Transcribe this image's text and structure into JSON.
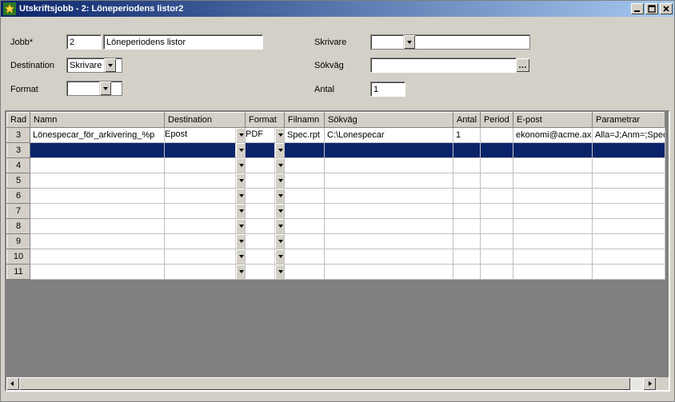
{
  "window": {
    "title": "Utskriftsjobb - 2: Löneperiodens listor2"
  },
  "form": {
    "jobb_label": "Jobb*",
    "jobb_id": "2",
    "jobb_name": "Löneperiodens listor",
    "destination_label": "Destination",
    "destination_value": "Skrivare",
    "format_label": "Format",
    "format_value": "",
    "skrivare_label": "Skrivare",
    "skrivare_value": "",
    "sokvag_label": "Sökväg",
    "sokvag_value": "",
    "antal_label": "Antal",
    "antal_value": "1"
  },
  "table": {
    "headers": {
      "rad": "Rad",
      "namn": "Namn",
      "destination": "Destination",
      "format": "Format",
      "filnamn": "Filnamn",
      "sokvag": "Sökväg",
      "antal": "Antal",
      "period": "Period",
      "epost": "E-post",
      "parametrar": "Parametrar"
    },
    "rows": [
      {
        "rad": "3",
        "namn": "Lönespecar_för_arkivering_%p",
        "destination": "Epost",
        "format": "PDF",
        "filnamn": "Spec.rpt",
        "sokvag": "C:\\Lonespecar",
        "antal": "1",
        "period": "",
        "epost": "ekonomi@acme.ax",
        "parametrar": "Alla=J;Anm=;SpecTyp=L;"
      },
      {
        "rad": "3",
        "namn": "",
        "destination": "",
        "format": "",
        "filnamn": "",
        "sokvag": "",
        "antal": "",
        "period": "",
        "epost": "",
        "parametrar": "",
        "selected": true
      },
      {
        "rad": "4",
        "namn": "",
        "destination": "",
        "format": "",
        "filnamn": "",
        "sokvag": "",
        "antal": "",
        "period": "",
        "epost": "",
        "parametrar": ""
      },
      {
        "rad": "5",
        "namn": "",
        "destination": "",
        "format": "",
        "filnamn": "",
        "sokvag": "",
        "antal": "",
        "period": "",
        "epost": "",
        "parametrar": ""
      },
      {
        "rad": "6",
        "namn": "",
        "destination": "",
        "format": "",
        "filnamn": "",
        "sokvag": "",
        "antal": "",
        "period": "",
        "epost": "",
        "parametrar": ""
      },
      {
        "rad": "7",
        "namn": "",
        "destination": "",
        "format": "",
        "filnamn": "",
        "sokvag": "",
        "antal": "",
        "period": "",
        "epost": "",
        "parametrar": ""
      },
      {
        "rad": "8",
        "namn": "",
        "destination": "",
        "format": "",
        "filnamn": "",
        "sokvag": "",
        "antal": "",
        "period": "",
        "epost": "",
        "parametrar": ""
      },
      {
        "rad": "9",
        "namn": "",
        "destination": "",
        "format": "",
        "filnamn": "",
        "sokvag": "",
        "antal": "",
        "period": "",
        "epost": "",
        "parametrar": ""
      },
      {
        "rad": "10",
        "namn": "",
        "destination": "",
        "format": "",
        "filnamn": "",
        "sokvag": "",
        "antal": "",
        "period": "",
        "epost": "",
        "parametrar": ""
      },
      {
        "rad": "11",
        "namn": "",
        "destination": "",
        "format": "",
        "filnamn": "",
        "sokvag": "",
        "antal": "",
        "period": "",
        "epost": "",
        "parametrar": ""
      }
    ]
  }
}
